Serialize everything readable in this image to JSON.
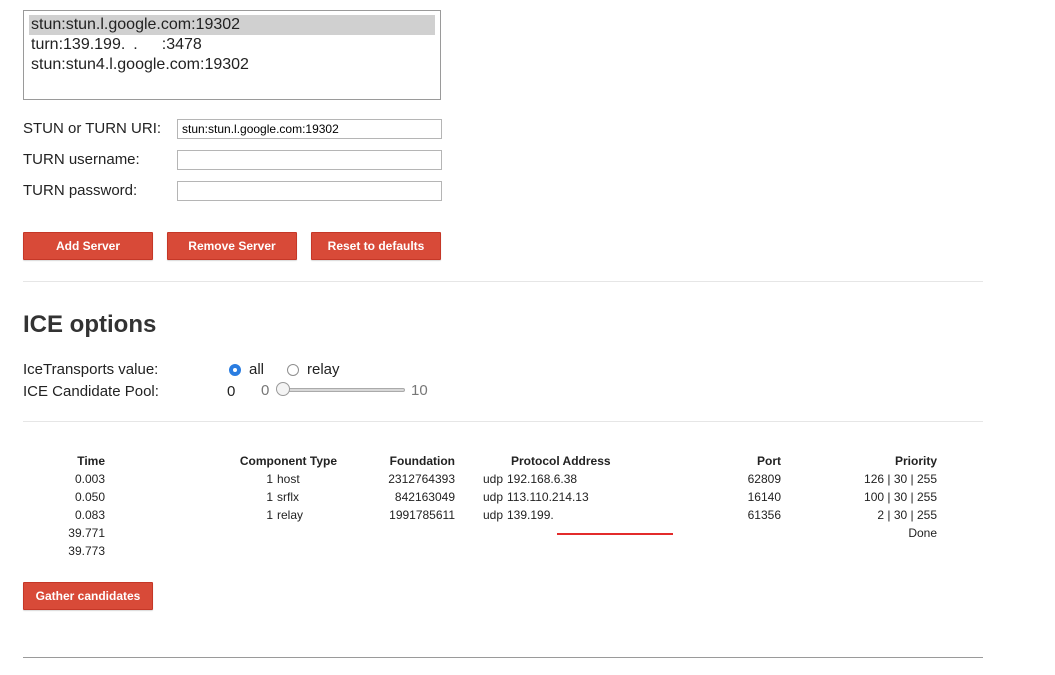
{
  "servers": {
    "options": [
      "stun:stun.l.google.com:19302",
      "turn:139.199. .  :3478",
      "stun:stun4.l.google.com:19302"
    ],
    "selected_index": 0
  },
  "form": {
    "uri_label": "STUN or TURN URI:",
    "uri_value": "stun:stun.l.google.com:19302",
    "username_label": "TURN username:",
    "username_value": "",
    "password_label": "TURN password:",
    "password_value": ""
  },
  "buttons": {
    "add": "Add Server",
    "remove": "Remove Server",
    "reset": "Reset to defaults",
    "gather": "Gather candidates"
  },
  "ice": {
    "title": "ICE options",
    "transports_label": "IceTransports value:",
    "transport_all": "all",
    "transport_relay": "relay",
    "selected_transport": "all",
    "pool_label": "ICE Candidate Pool:",
    "pool_value": "0",
    "pool_min": "0",
    "pool_max": "10"
  },
  "candidates": {
    "headers": {
      "time": "Time",
      "component_type": "Component Type",
      "foundation": "Foundation",
      "protocol_address": "Protocol Address",
      "port": "Port",
      "priority": "Priority"
    },
    "rows": [
      {
        "time": "0.003",
        "component": "1",
        "type": "host",
        "foundation": "2312764393",
        "protocol": "udp",
        "address": "192.168.6.38",
        "port": "62809",
        "priority": "126 | 30 | 255"
      },
      {
        "time": "0.050",
        "component": "1",
        "type": "srflx",
        "foundation": "842163049",
        "protocol": "udp",
        "address": "113.110.214.13",
        "port": "16140",
        "priority": "100 | 30 | 255"
      },
      {
        "time": "0.083",
        "component": "1",
        "type": "relay",
        "foundation": "1991785611",
        "protocol": "udp",
        "address": "139.199.",
        "port": "61356",
        "priority": "2 | 30 | 255"
      },
      {
        "time": "39.771",
        "component": "",
        "type": "",
        "foundation": "",
        "protocol": "",
        "address": "",
        "port": "",
        "priority": "Done"
      },
      {
        "time": "39.773",
        "component": "",
        "type": "",
        "foundation": "",
        "protocol": "",
        "address": "",
        "port": "",
        "priority": ""
      }
    ]
  },
  "colors": {
    "button": "#d84a38",
    "radio_accent": "#2a7de1",
    "underline": "#e32b2b"
  }
}
